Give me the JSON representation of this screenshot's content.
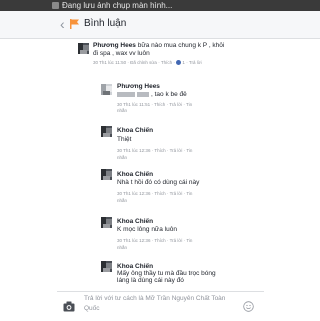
{
  "status_bar": {
    "text": "Đang lưu ảnh chụp màn hình..."
  },
  "header": {
    "title": "Bình luận"
  },
  "comments": [
    {
      "name": "Phương Hees",
      "text_line1": "bữa nào mua chung k P , khỏi",
      "text_line2": "đi spa , wax vv luôn",
      "time": "30 Th1 lúc 11:50",
      "sep": "·",
      "edited": "Đã chỉnh sửa",
      "like": "Thích",
      "reply_count": "1",
      "reply": "Trả lời"
    }
  ],
  "replies": [
    {
      "name": "Phương Hees",
      "text": ", tao k be đê"
    },
    {
      "name": "Khoa Chiến",
      "text": "Thiệt",
      "time": "30 Th1 lúc 12:36"
    },
    {
      "name": "Khoa Chiến",
      "text": "Nhà t hồi đó có dùng cái này",
      "time": "30 Th1 lúc 12:36"
    },
    {
      "name": "Khoa Chiến",
      "text": "K mọc lông nữa luôn",
      "time": "30 Th1 lúc 12:36"
    },
    {
      "name": "Khoa Chiến",
      "text_line1": "Mấy ông thầy tu mà đầu trọc bóng",
      "text_line2": "láng là dùng cái này đó",
      "time": "30 Th1 lúc 12:37"
    }
  ],
  "reply_meta": {
    "time_generic": "30 Th1 lúc 11:51",
    "sep": "·",
    "like": "Thích",
    "reply": "Trả lời",
    "message_line1": "Tin",
    "message_line2": "nhắn",
    "like_count": "1"
  },
  "reply_bar": {
    "placeholder": "Trả lời với tư cách là Mỡ Trần Nguyên Chất Toàn Quốc"
  },
  "colors": {
    "accent": "#f7923a",
    "link": "#4267b2",
    "meta": "#90949c",
    "text": "#1d2129"
  },
  "icons": [
    "flag-icon",
    "chevron-left-icon",
    "camera-icon",
    "sticker-icon",
    "thumbs-up-icon"
  ]
}
